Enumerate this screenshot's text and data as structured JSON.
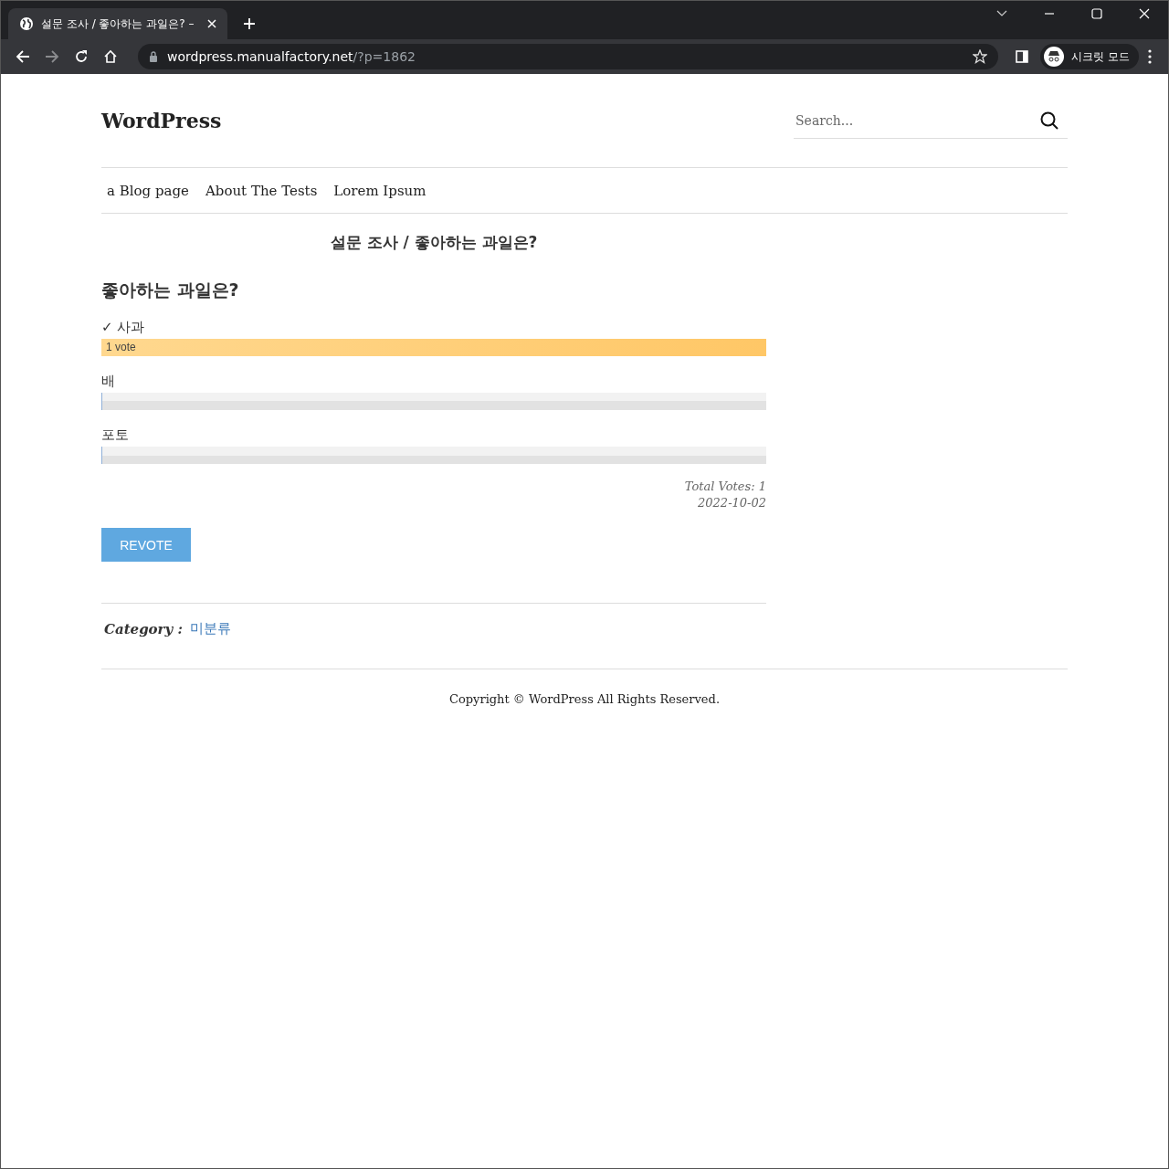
{
  "browser": {
    "tab_title": "설문 조사 / 좋아하는 과일은? –",
    "url_host": "wordpress.manualfactory.net",
    "url_path": "/?p=1862",
    "profile_label": "시크릿 모드"
  },
  "site": {
    "title": "WordPress",
    "search": {
      "placeholder": "Search..."
    }
  },
  "nav": {
    "items": [
      "a Blog page",
      "About The Tests",
      "Lorem Ipsum"
    ]
  },
  "post": {
    "title": "설문 조사 / 좋아하는 과일은?",
    "poll": {
      "question": "좋아하는 과일은?",
      "answers": [
        {
          "label": "✓ 사과",
          "level": 1,
          "votes": "1 vote"
        },
        {
          "label": "배",
          "level": 0
        },
        {
          "label": "포토",
          "level": 0
        }
      ],
      "total": "Total Votes: 1",
      "date": "2022-10-02",
      "button": "REVOTE"
    },
    "category_label": "Category :",
    "category": "미분류"
  },
  "footer": {
    "copyright": "Copyright © WordPress All Rights Reserved."
  }
}
